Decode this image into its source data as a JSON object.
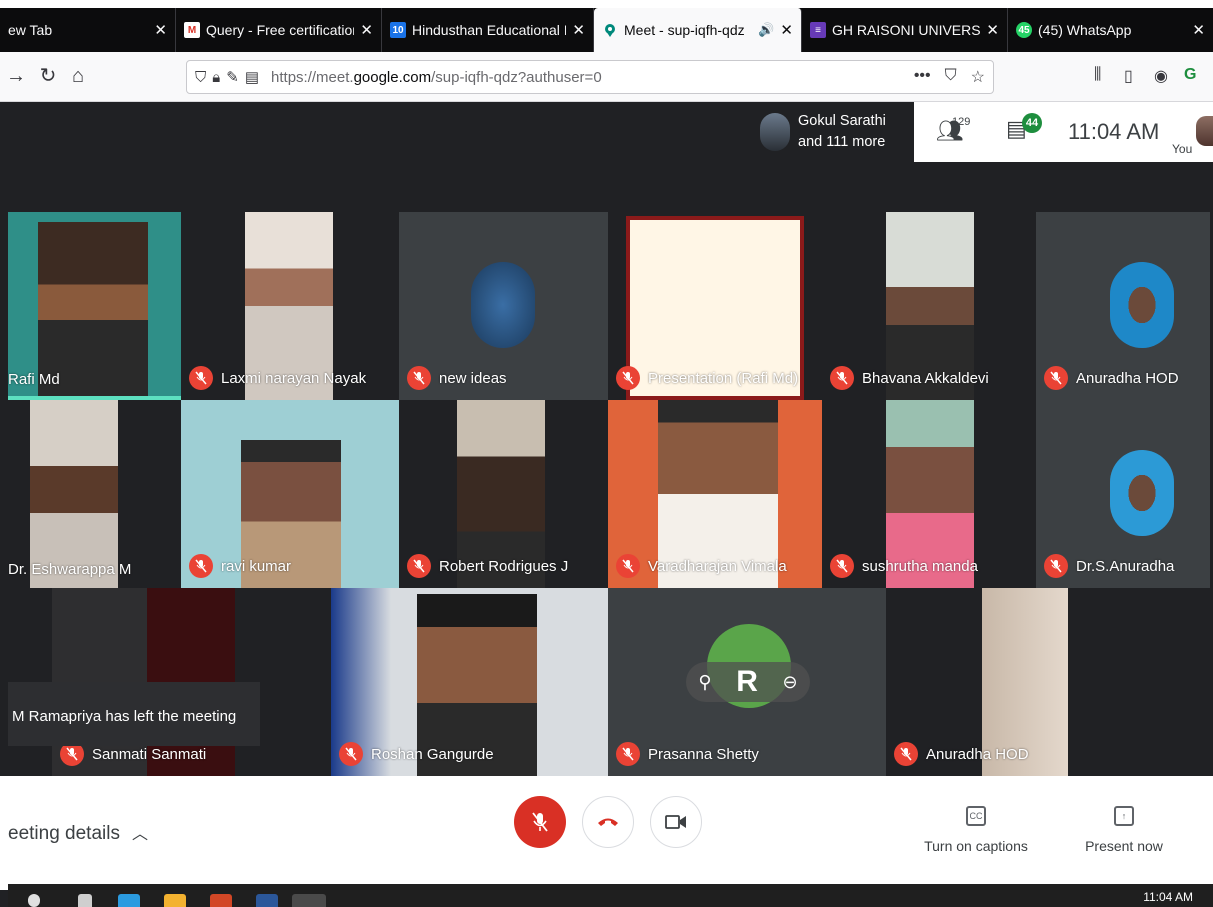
{
  "browser": {
    "tabs": [
      {
        "label": "ew Tab",
        "favicon": "",
        "active": false
      },
      {
        "label": "Query - Free certification onlin",
        "favicon": "gmail-icon",
        "active": false
      },
      {
        "label": "Hindusthan Educational Institu",
        "favicon": "calendar-icon",
        "favicon_text": "10",
        "active": false
      },
      {
        "label": "Meet - sup-iqfh-qdz",
        "favicon": "meet-icon",
        "active": true
      },
      {
        "label": "GH RAISONI UNIVERSITY - Goo",
        "favicon": "forms-icon",
        "active": false
      },
      {
        "label": "(45) WhatsApp",
        "favicon": "whatsapp-icon",
        "favicon_text": "45",
        "active": false
      }
    ],
    "url_host": "https://meet.",
    "url_domain": "google.com",
    "url_path": "/sup-iqfh-qdz?authuser=0"
  },
  "meet": {
    "presenter_name": "Gokul Sarathi",
    "presenter_more": "and 111 more",
    "people_count": "129",
    "chat_count": "44",
    "time": "11:04 AM",
    "you_label": "You",
    "tiles": [
      {
        "name": "Rafi Md",
        "muted": false
      },
      {
        "name": "Laxmi narayan Nayak",
        "muted": true
      },
      {
        "name": "new ideas",
        "muted": true
      },
      {
        "name": "Presentation (Rafi Md)",
        "muted": true
      },
      {
        "name": "Bhavana Akkaldevi",
        "muted": true
      },
      {
        "name": "Anuradha HOD",
        "muted": true
      },
      {
        "name": "Dr. Eshwarappa M",
        "muted": false
      },
      {
        "name": "ravi kumar",
        "muted": true
      },
      {
        "name": "Robert Rodrigues J",
        "muted": true
      },
      {
        "name": "Varadharajan Vimala",
        "muted": true
      },
      {
        "name": "sushrutha manda",
        "muted": true
      },
      {
        "name": "Dr.S.Anuradha",
        "muted": true
      },
      {
        "name": "Sanmati Sanmati",
        "muted": true
      },
      {
        "name": "Roshan Gangurde",
        "muted": true
      },
      {
        "name": "Prasanna Shetty",
        "muted": true
      },
      {
        "name": "Anuradha HOD",
        "muted": true
      }
    ],
    "toast": "M Ramapriya has left the meeting",
    "pin_letter": "R",
    "meeting_details": "eeting details",
    "captions_label": "Turn on captions",
    "present_label": "Present now",
    "captions_icon_text": "CC"
  },
  "taskbar": {
    "time": "11:04 AM"
  },
  "colors": {
    "accent_red": "#ea4335",
    "meet_bg": "#202124",
    "chat_badge": "#1e8e3e"
  }
}
